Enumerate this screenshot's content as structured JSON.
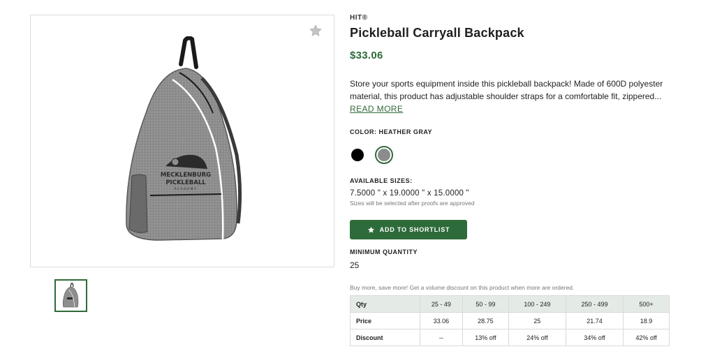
{
  "product": {
    "brand": "HIT®",
    "title": "Pickleball Carryall Backpack",
    "price": "$33.06",
    "description": "Store your sports equipment inside this pickleball backpack! Made of 600D polyester material, this product has adjustable shoulder straps for a comfortable fit, zippered...",
    "read_more": "READ MORE",
    "imprint_lines": [
      "MECKLENBURG",
      "PICKLEBALL",
      "ACADEMY"
    ]
  },
  "color": {
    "label": "COLOR: HEATHER GRAY",
    "options": [
      {
        "name": "Black",
        "hex": "#000000",
        "selected": false
      },
      {
        "name": "Heather Gray",
        "hex": "#8c8c8c",
        "selected": true
      }
    ]
  },
  "sizes": {
    "label": "AVAILABLE SIZES:",
    "value": "7.5000 \" x 19.0000 \" x 15.0000 \"",
    "note": "Sizes will be selected after proofs are approved"
  },
  "actions": {
    "shortlist_label": "ADD TO SHORTLIST"
  },
  "minimum": {
    "label": "MINIMUM QUANTITY",
    "value": "25"
  },
  "pricing": {
    "note": "Buy more, save more! Get a volume discount on this product when more are ordered.",
    "header": [
      "Qty",
      "25 - 49",
      "50 - 99",
      "100 - 249",
      "250 - 499",
      "500+"
    ],
    "price_row": [
      "Price",
      "33.06",
      "28.75",
      "25",
      "21.74",
      "18.9"
    ],
    "discount_row": [
      "Discount",
      "--",
      "13% off",
      "24% off",
      "34% off",
      "42% off"
    ]
  },
  "colors": {
    "accent": "#2e6b3a",
    "bag_gray": "#8c8c8c"
  }
}
